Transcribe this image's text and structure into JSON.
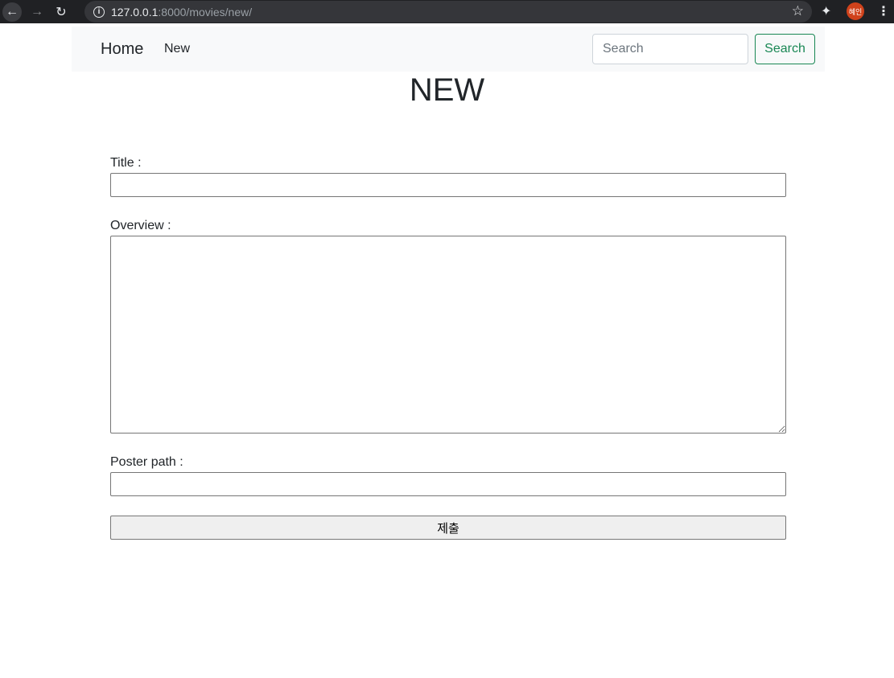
{
  "browser": {
    "url_host": "127.0.0.1",
    "url_path": ":8000/movies/new/",
    "profile_initials": "혜인"
  },
  "navbar": {
    "brand": "Home",
    "new_link": "New",
    "search_placeholder": "Search",
    "search_button": "Search"
  },
  "page": {
    "title": "NEW"
  },
  "form": {
    "title_label": "Title :",
    "title_value": "",
    "overview_label": "Overview :",
    "overview_value": "",
    "poster_label": "Poster path :",
    "poster_value": "",
    "submit_label": "제출"
  }
}
